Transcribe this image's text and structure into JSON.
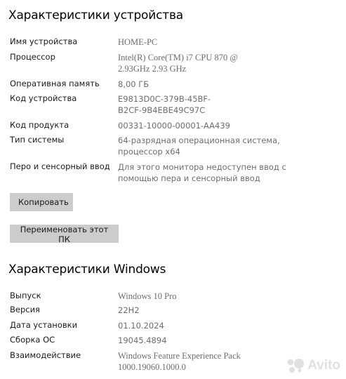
{
  "device_section": {
    "title": "Характеристики устройства",
    "rows": [
      {
        "label": "Имя устройства",
        "value": "HOME-PC"
      },
      {
        "label": "Процессор",
        "value": "Intel(R) Core(TM) i7 CPU         870  @\n2.93GHz   2.93 GHz"
      },
      {
        "label": "Оперативная память",
        "value": "8,00 ГБ"
      },
      {
        "label": "Код устройства",
        "value": "E9813D0C-379B-45BF-\nB2CF-9B4EBE49C97C"
      },
      {
        "label": "Код продукта",
        "value": "00331-10000-00001-AA439"
      },
      {
        "label": "Тип системы",
        "value": "64-разрядная операционная система,\nпроцессор x64"
      },
      {
        "label": "Перо и сенсорный ввод",
        "value": "Для этого монитора недоступен ввод с\nпомощью пера и сенсорный ввод"
      }
    ],
    "copy_button": "Копировать",
    "rename_button": "Переименовать этот ПК"
  },
  "windows_section": {
    "title": "Характеристики Windows",
    "rows": [
      {
        "label": "Выпуск",
        "value": "Windows 10 Pro"
      },
      {
        "label": "Версия",
        "value": "22H2"
      },
      {
        "label": "Дата установки",
        "value": "01.10.2024"
      },
      {
        "label": "Сборка ОС",
        "value": "19045.4894"
      },
      {
        "label": "Взаимодействие",
        "value": "Windows Feature Experience Pack\n1000.19060.1000.0"
      }
    ]
  },
  "watermark": {
    "text": "Avito",
    "icon": "avito-logo-icon"
  }
}
